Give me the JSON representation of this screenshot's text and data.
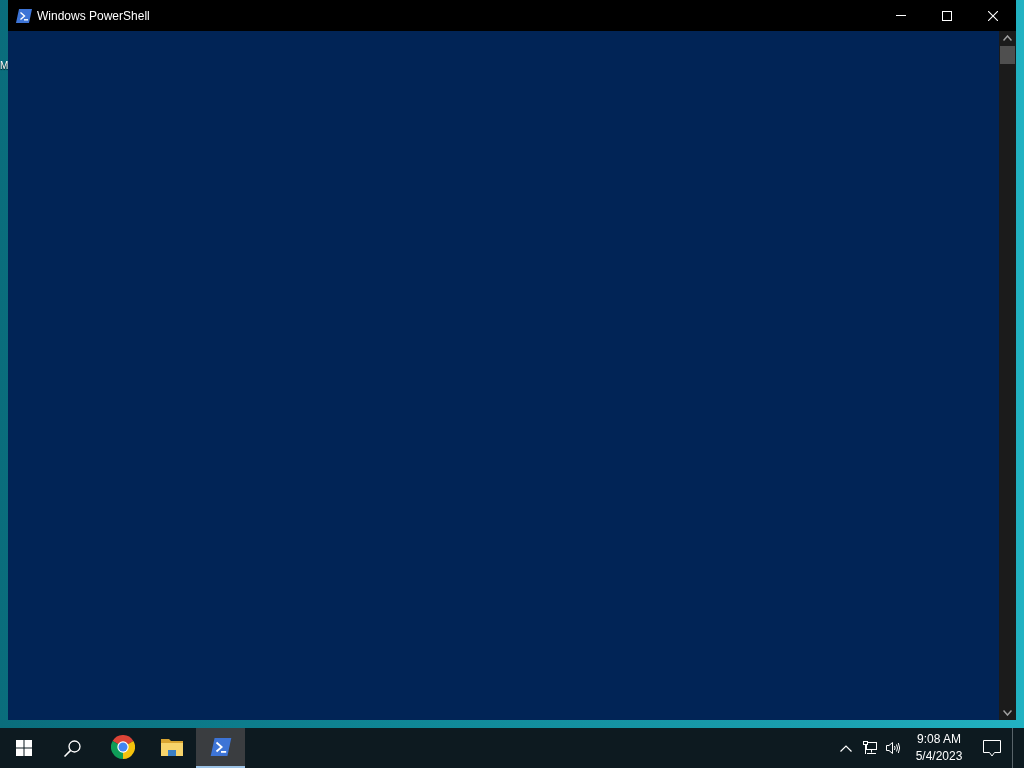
{
  "desktop": {
    "icon_label": "M"
  },
  "window": {
    "title": "Windows PowerShell"
  },
  "taskbar": {
    "apps": [
      {
        "kind": "browser",
        "selected": false
      },
      {
        "kind": "folder",
        "selected": false
      },
      {
        "kind": "terminal",
        "selected": true
      }
    ],
    "clock": {
      "time": "9:08 AM",
      "date": "5/4/2023"
    }
  }
}
